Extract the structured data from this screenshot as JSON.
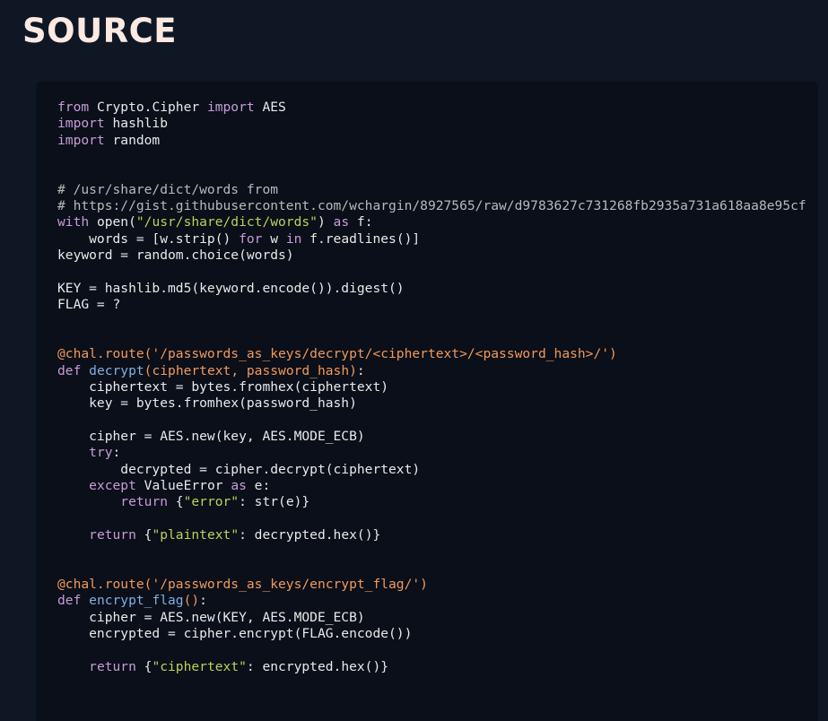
{
  "page": {
    "title": "SOURCE"
  },
  "colors": {
    "background": "#0f1724",
    "code_panel_bg": "#0a0f19",
    "title": "#fbe9e2",
    "keyword": "#c89bd9",
    "function": "#82aee3",
    "string": "#bed05a",
    "decorator": "#f2995b",
    "comment": "#b9b9b9",
    "plain": "#e9e9e9"
  },
  "code": {
    "language": "python",
    "lines": [
      [
        [
          "kw",
          "from"
        ],
        [
          "pln",
          " Crypto.Cipher "
        ],
        [
          "kw",
          "import"
        ],
        [
          "pln",
          " AES"
        ]
      ],
      [
        [
          "kw",
          "import"
        ],
        [
          "pln",
          " hashlib"
        ]
      ],
      [
        [
          "kw",
          "import"
        ],
        [
          "pln",
          " random"
        ]
      ],
      [],
      [],
      [
        [
          "cmt",
          "# /usr/share/dict/words from"
        ]
      ],
      [
        [
          "cmt",
          "# https://gist.githubusercontent.com/wchargin/8927565/raw/d9783627c731268fb2935a731a618aa8e95cf"
        ]
      ],
      [
        [
          "kw",
          "with"
        ],
        [
          "pln",
          " open("
        ],
        [
          "str",
          "\"/usr/share/dict/words\""
        ],
        [
          "pln",
          ") "
        ],
        [
          "kw",
          "as"
        ],
        [
          "pln",
          " f:"
        ]
      ],
      [
        [
          "pln",
          "    words = [w.strip() "
        ],
        [
          "kw",
          "for"
        ],
        [
          "pln",
          " w "
        ],
        [
          "kw",
          "in"
        ],
        [
          "pln",
          " f.readlines()]"
        ]
      ],
      [
        [
          "pln",
          "keyword = random.choice(words)"
        ]
      ],
      [],
      [
        [
          "pln",
          "KEY = hashlib.md5(keyword.encode()).digest()"
        ]
      ],
      [
        [
          "pln",
          "FLAG = ?"
        ]
      ],
      [],
      [],
      [
        [
          "dec",
          "@chal.route('/passwords_as_keys/decrypt/<ciphertext>/<password_hash>/')"
        ]
      ],
      [
        [
          "kw",
          "def"
        ],
        [
          "pln",
          " "
        ],
        [
          "fn",
          "decrypt"
        ],
        [
          "dec",
          "(ciphertext, password_hash)"
        ],
        [
          "pln",
          ":"
        ]
      ],
      [
        [
          "pln",
          "    ciphertext = bytes.fromhex(ciphertext)"
        ]
      ],
      [
        [
          "pln",
          "    key = bytes.fromhex(password_hash)"
        ]
      ],
      [],
      [
        [
          "pln",
          "    cipher = AES.new(key, AES.MODE_ECB)"
        ]
      ],
      [
        [
          "pln",
          "    "
        ],
        [
          "kw",
          "try"
        ],
        [
          "pln",
          ":"
        ]
      ],
      [
        [
          "pln",
          "        decrypted = cipher.decrypt(ciphertext)"
        ]
      ],
      [
        [
          "pln",
          "    "
        ],
        [
          "kw",
          "except"
        ],
        [
          "pln",
          " ValueError "
        ],
        [
          "kw",
          "as"
        ],
        [
          "pln",
          " e:"
        ]
      ],
      [
        [
          "pln",
          "        "
        ],
        [
          "kw",
          "return"
        ],
        [
          "pln",
          " {"
        ],
        [
          "str",
          "\"error\""
        ],
        [
          "pln",
          ": str(e)}"
        ]
      ],
      [],
      [
        [
          "pln",
          "    "
        ],
        [
          "kw",
          "return"
        ],
        [
          "pln",
          " {"
        ],
        [
          "str",
          "\"plaintext\""
        ],
        [
          "pln",
          ": decrypted.hex()}"
        ]
      ],
      [],
      [],
      [
        [
          "dec",
          "@chal.route('/passwords_as_keys/encrypt_flag/')"
        ]
      ],
      [
        [
          "kw",
          "def"
        ],
        [
          "pln",
          " "
        ],
        [
          "fn",
          "encrypt_flag"
        ],
        [
          "dec",
          "()"
        ],
        [
          "pln",
          ":"
        ]
      ],
      [
        [
          "pln",
          "    cipher = AES.new(KEY, AES.MODE_ECB)"
        ]
      ],
      [
        [
          "pln",
          "    encrypted = cipher.encrypt(FLAG.encode())"
        ]
      ],
      [],
      [
        [
          "pln",
          "    "
        ],
        [
          "kw",
          "return"
        ],
        [
          "pln",
          " {"
        ],
        [
          "str",
          "\"ciphertext\""
        ],
        [
          "pln",
          ": encrypted.hex()}"
        ]
      ]
    ]
  }
}
